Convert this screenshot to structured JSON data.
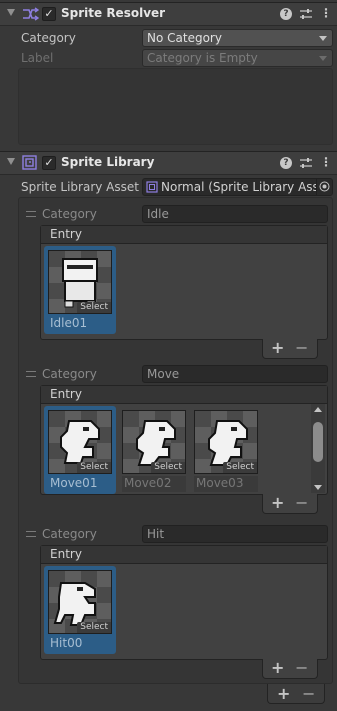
{
  "sprite_resolver": {
    "title": "Sprite Resolver",
    "category_label": "Category",
    "category_value": "No Category",
    "label_label": "Label",
    "label_value": "Category is Empty"
  },
  "sprite_library": {
    "title": "Sprite Library",
    "asset_label": "Sprite Library Asset",
    "asset_value": "Normal (Sprite Library Asset)",
    "categories": [
      {
        "label": "Category",
        "name": "Idle",
        "entry_header": "Entry",
        "entries": [
          {
            "name": "Idle01",
            "select": "Select"
          }
        ]
      },
      {
        "label": "Category",
        "name": "Move",
        "entry_header": "Entry",
        "entries": [
          {
            "name": "Move01",
            "select": "Select"
          },
          {
            "name": "Move02",
            "select": "Select"
          },
          {
            "name": "Move03",
            "select": "Select"
          }
        ]
      },
      {
        "label": "Category",
        "name": "Hit",
        "entry_header": "Entry",
        "entries": [
          {
            "name": "Hit00",
            "select": "Select"
          }
        ]
      }
    ]
  },
  "buttons": {
    "add": "+",
    "remove": "−"
  },
  "icons": {
    "help": "?",
    "kebab": "⋮",
    "check": "✓"
  },
  "colors": {
    "selection": "#2c5d87",
    "panel_bg": "#383838",
    "header_bg": "#3e3e3e"
  }
}
